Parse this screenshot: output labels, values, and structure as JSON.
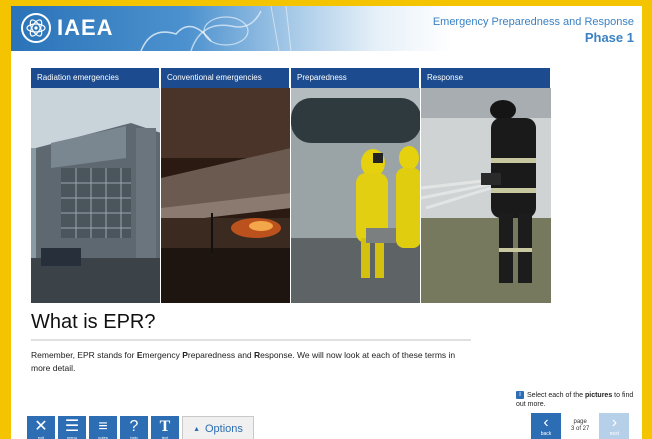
{
  "header": {
    "logo_text": "IAEA",
    "title": "Emergency Preparedness and Response",
    "phase": "Phase 1"
  },
  "panels": [
    {
      "label": "Radiation emergencies"
    },
    {
      "label": "Conventional emergencies"
    },
    {
      "label": "Preparedness"
    },
    {
      "label": "Response"
    }
  ],
  "main": {
    "heading": "What is EPR?",
    "body_pre": "Remember, EPR stands for ",
    "body_e": "E",
    "body_mergency": "mergency ",
    "body_p": "P",
    "body_reparedness": "reparedness and ",
    "body_r": "R",
    "body_post": "esponse. We will now look at each of these terms in more detail."
  },
  "hint": {
    "pre": "Select each of the ",
    "bold": "pictures",
    "post": " to find out more."
  },
  "toolbar": {
    "exit_label": "exit",
    "menu_label": "menu",
    "notes_label": "notes",
    "help_label": "help",
    "text_label": "text",
    "options_label": "Options"
  },
  "nav": {
    "back_label": "back",
    "next_label": "next",
    "page_word": "page",
    "page_of": "3 of 27"
  },
  "colors": {
    "frame_border": "#f5c400",
    "brand_blue": "#2c6db3",
    "panel_label_bg": "#1c4c8f"
  }
}
